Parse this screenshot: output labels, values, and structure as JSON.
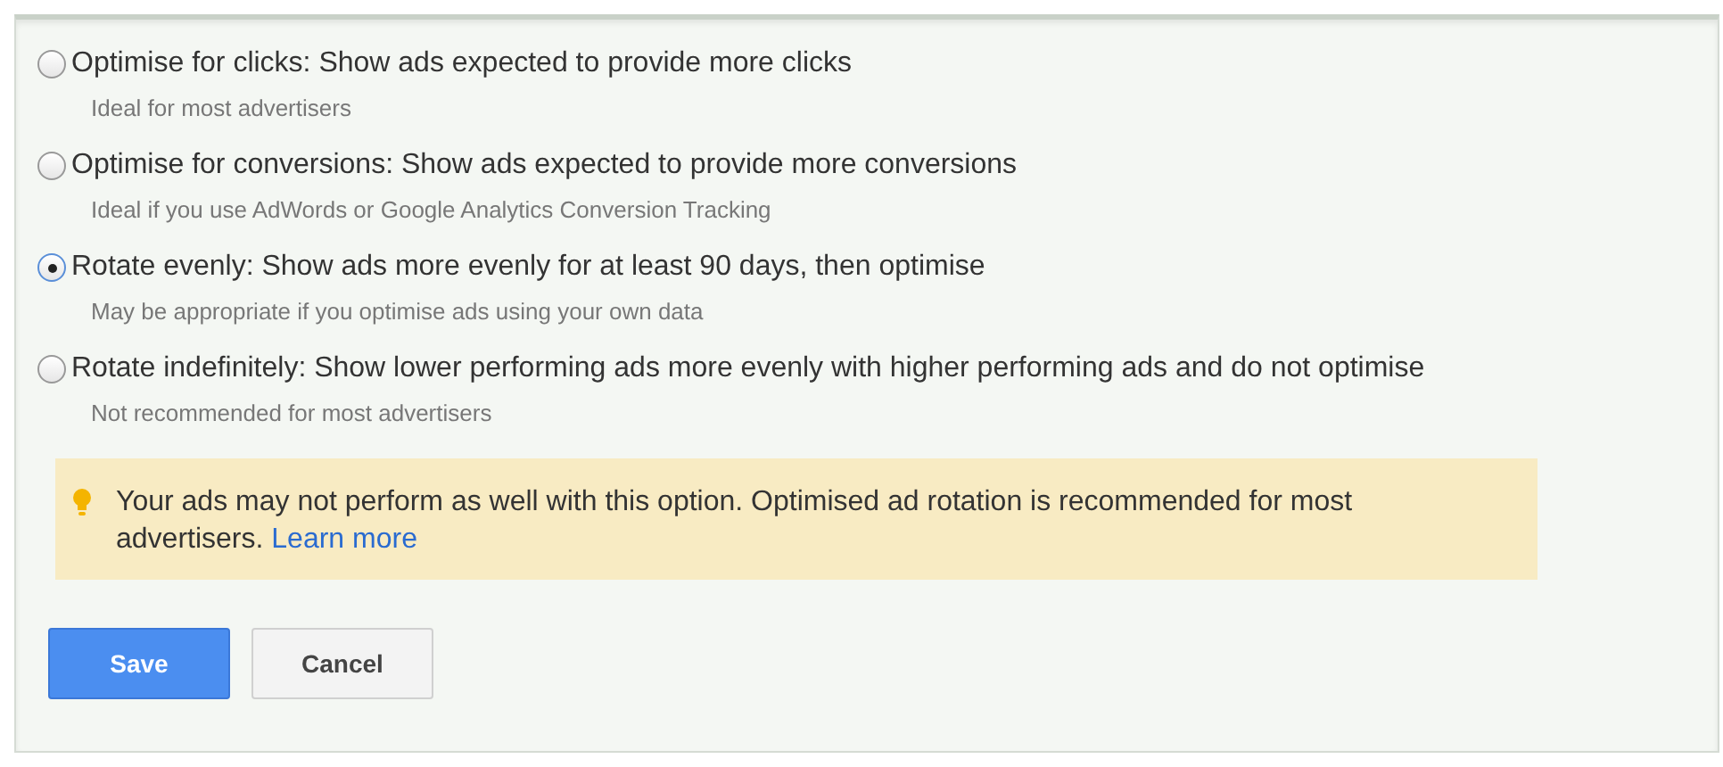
{
  "options": [
    {
      "label": "Optimise for clicks: Show ads expected to provide more clicks",
      "hint": "Ideal for most advertisers",
      "selected": false
    },
    {
      "label": "Optimise for conversions: Show ads expected to provide more conversions",
      "hint": "Ideal if you use AdWords or Google Analytics Conversion Tracking",
      "selected": false
    },
    {
      "label": "Rotate evenly: Show ads more evenly for at least 90 days, then optimise",
      "hint": "May be appropriate if you optimise ads using your own data",
      "selected": true
    },
    {
      "label": "Rotate indefinitely: Show lower performing ads more evenly with higher performing ads and do not optimise",
      "hint": "Not recommended for most advertisers",
      "selected": false
    }
  ],
  "warning": {
    "text": "Your ads may not perform as well with this option. Optimised ad rotation is recommended for most advertisers.",
    "link": "Learn more"
  },
  "buttons": [
    {
      "label": "Save",
      "kind": "primary"
    },
    {
      "label": "Cancel",
      "kind": "secondary"
    }
  ]
}
